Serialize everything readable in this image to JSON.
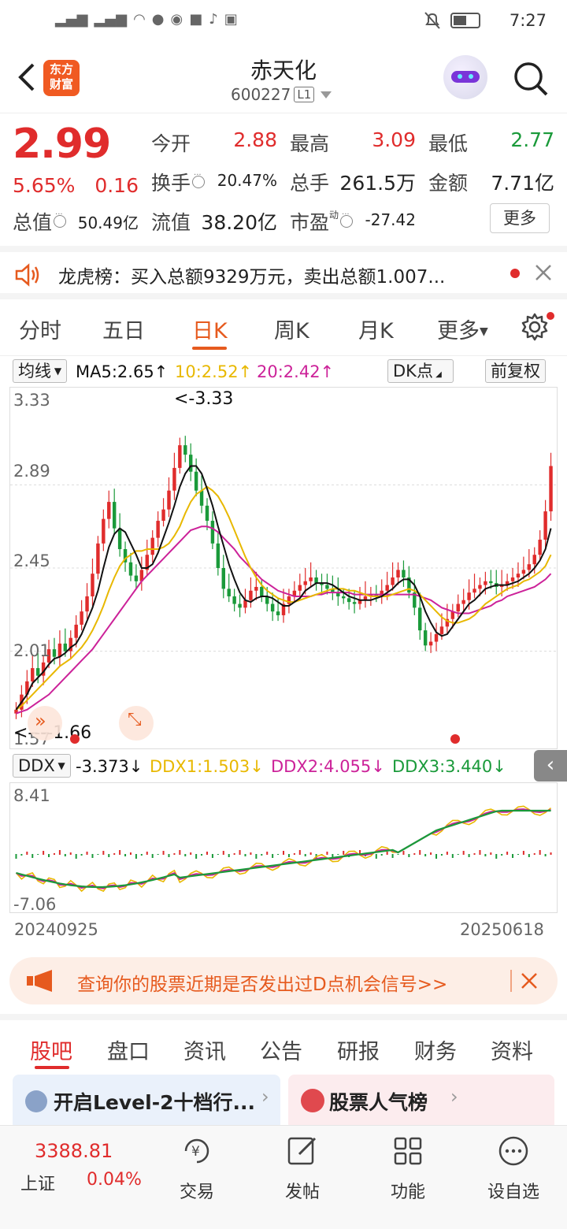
{
  "status_bar": {
    "time": "7:27"
  },
  "header": {
    "back_label": "返回",
    "logo_line1": "东方",
    "logo_line2": "财富",
    "stock_name": "赤天化",
    "stock_code": "600227",
    "level": "L1"
  },
  "quote": {
    "price": "2.99",
    "change_pct": "5.65%",
    "change": "0.16",
    "open_label": "今开",
    "open": "2.88",
    "high_label": "最高",
    "high": "3.09",
    "low_label": "最低",
    "low": "2.77",
    "turnover_label": "换手",
    "turnover": "20.47%",
    "volume_label": "总手",
    "volume": "261.5万",
    "amount_label": "金额",
    "amount": "7.71亿",
    "total_mv_label": "总值",
    "total_mv": "50.49亿",
    "float_mv_label": "流值",
    "float_mv": "38.20亿",
    "pe_label": "市盈",
    "pe_sup": "动",
    "pe": "-27.42",
    "more_label": "更多"
  },
  "notice": {
    "text": "龙虎榜：买入总额9329万元，卖出总额1.007..."
  },
  "period_tabs": [
    "分时",
    "五日",
    "日K",
    "周K",
    "月K",
    "更多"
  ],
  "active_period": "日K",
  "chart_head": {
    "ma_select": "均线",
    "ma5": "MA5:2.65↑",
    "ma10": "10:2.52↑",
    "ma20": "20:2.42↑",
    "dk_select": "DK点",
    "adjust": "前复权"
  },
  "colors": {
    "accent": "#e65a1e",
    "up": "#e02c2c",
    "down": "#1a9a3a",
    "ma5": "#111111",
    "ma10": "#e8b800",
    "ma20": "#cc2299",
    "ddx3": "#1a9a3a"
  },
  "kline_axis": {
    "y_top": "3.33",
    "y_2": "2.89",
    "y_3": "2.45",
    "y_4": "2.01",
    "y_bottom": "1.57",
    "max_mark": "<-3.33",
    "min_mark": "<----1.66"
  },
  "ddx_head": {
    "select": "DDX",
    "ddx": "-3.373↓",
    "ddx1": "DDX1:1.503↓",
    "ddx2": "DDX2:4.055↓",
    "ddx3": "DDX3:3.440↓"
  },
  "ddx_axis": {
    "y_top": "8.41",
    "y_bottom": "-7.06",
    "date_start": "20240925",
    "date_end": "20250618"
  },
  "promo": {
    "text": "查询你的股票近期是否发出过D点机会信号>>"
  },
  "bottom_tabs": [
    "股吧",
    "盘口",
    "资讯",
    "公告",
    "研报",
    "财务",
    "资料"
  ],
  "cards": {
    "left": "开启Level-2十档行...",
    "right": "股票人气榜"
  },
  "footer": {
    "index_value": "3388.81",
    "index_name": "上证",
    "index_change": "0.04%",
    "trade": "交易",
    "post": "发帖",
    "function": "功能",
    "custom": "设自选"
  },
  "chart_data": {
    "type": "candlestick",
    "x_start": "20240925",
    "x_end": "20250618",
    "ylim": [
      1.57,
      3.33
    ],
    "max": 3.33,
    "min": 1.66,
    "close": [
      1.7,
      1.78,
      1.85,
      1.92,
      1.88,
      1.95,
      2.02,
      1.98,
      2.05,
      2.01,
      2.08,
      2.15,
      2.22,
      2.3,
      2.42,
      2.58,
      2.71,
      2.8,
      2.66,
      2.55,
      2.48,
      2.41,
      2.38,
      2.44,
      2.52,
      2.61,
      2.7,
      2.76,
      2.86,
      2.98,
      3.1,
      3.05,
      2.96,
      2.86,
      2.78,
      2.7,
      2.58,
      2.45,
      2.34,
      2.3,
      2.26,
      2.24,
      2.28,
      2.33,
      2.35,
      2.3,
      2.26,
      2.22,
      2.2,
      2.26,
      2.3,
      2.33,
      2.36,
      2.38,
      2.4,
      2.37,
      2.36,
      2.34,
      2.32,
      2.3,
      2.29,
      2.27,
      2.26,
      2.28,
      2.3,
      2.31,
      2.3,
      2.33,
      2.36,
      2.4,
      2.44,
      2.4,
      2.32,
      2.24,
      2.12,
      2.04,
      2.06,
      2.1,
      2.14,
      2.18,
      2.22,
      2.26,
      2.28,
      2.32,
      2.34,
      2.36,
      2.38,
      2.37,
      2.35,
      2.36,
      2.38,
      2.4,
      2.42,
      2.44,
      2.47,
      2.52,
      2.6,
      2.75,
      2.99
    ],
    "ma5": [
      1.7,
      1.74,
      1.78,
      1.84,
      1.87,
      1.9,
      1.94,
      1.97,
      1.98,
      2.0,
      2.03,
      2.05,
      2.1,
      2.17,
      2.24,
      2.33,
      2.45,
      2.56,
      2.63,
      2.66,
      2.64,
      2.58,
      2.52,
      2.45,
      2.45,
      2.47,
      2.53,
      2.61,
      2.69,
      2.78,
      2.88,
      2.95,
      2.99,
      2.99,
      2.95,
      2.87,
      2.78,
      2.67,
      2.57,
      2.47,
      2.39,
      2.32,
      2.28,
      2.27,
      2.29,
      2.3,
      2.3,
      2.29,
      2.27,
      2.25,
      2.25,
      2.27,
      2.29,
      2.33,
      2.35,
      2.37,
      2.37,
      2.37,
      2.36,
      2.34,
      2.32,
      2.3,
      2.29,
      2.28,
      2.28,
      2.28,
      2.29,
      2.3,
      2.32,
      2.34,
      2.37,
      2.39,
      2.39,
      2.36,
      2.3,
      2.22,
      2.16,
      2.11,
      2.09,
      2.1,
      2.14,
      2.18,
      2.22,
      2.26,
      2.28,
      2.31,
      2.34,
      2.35,
      2.36,
      2.36,
      2.36,
      2.37,
      2.38,
      2.4,
      2.42,
      2.45,
      2.49,
      2.55,
      2.66
    ],
    "ma10": [
      1.7,
      1.72,
      1.75,
      1.78,
      1.81,
      1.84,
      1.87,
      1.9,
      1.93,
      1.95,
      1.97,
      2.0,
      2.03,
      2.07,
      2.12,
      2.18,
      2.25,
      2.33,
      2.4,
      2.46,
      2.5,
      2.52,
      2.54,
      2.54,
      2.55,
      2.55,
      2.55,
      2.56,
      2.58,
      2.62,
      2.67,
      2.74,
      2.8,
      2.84,
      2.86,
      2.88,
      2.86,
      2.83,
      2.78,
      2.72,
      2.65,
      2.58,
      2.51,
      2.45,
      2.4,
      2.36,
      2.33,
      2.31,
      2.29,
      2.28,
      2.27,
      2.27,
      2.28,
      2.29,
      2.3,
      2.31,
      2.32,
      2.33,
      2.34,
      2.34,
      2.34,
      2.33,
      2.33,
      2.32,
      2.31,
      2.3,
      2.3,
      2.3,
      2.3,
      2.31,
      2.32,
      2.33,
      2.34,
      2.33,
      2.31,
      2.28,
      2.25,
      2.22,
      2.19,
      2.17,
      2.16,
      2.16,
      2.17,
      2.18,
      2.2,
      2.23,
      2.26,
      2.28,
      2.3,
      2.32,
      2.34,
      2.35,
      2.36,
      2.38,
      2.39,
      2.41,
      2.43,
      2.46,
      2.52
    ],
    "ma20": [
      1.68,
      1.69,
      1.7,
      1.72,
      1.74,
      1.76,
      1.78,
      1.81,
      1.84,
      1.87,
      1.9,
      1.93,
      1.96,
      1.99,
      2.02,
      2.06,
      2.1,
      2.14,
      2.18,
      2.22,
      2.26,
      2.3,
      2.34,
      2.38,
      2.41,
      2.44,
      2.47,
      2.5,
      2.53,
      2.56,
      2.59,
      2.62,
      2.65,
      2.66,
      2.67,
      2.67,
      2.66,
      2.64,
      2.61,
      2.58,
      2.55,
      2.51,
      2.48,
      2.45,
      2.42,
      2.39,
      2.37,
      2.35,
      2.33,
      2.32,
      2.31,
      2.3,
      2.3,
      2.3,
      2.3,
      2.31,
      2.31,
      2.32,
      2.32,
      2.32,
      2.32,
      2.32,
      2.31,
      2.31,
      2.31,
      2.31,
      2.31,
      2.31,
      2.31,
      2.31,
      2.31,
      2.31,
      2.31,
      2.31,
      2.3,
      2.29,
      2.28,
      2.26,
      2.24,
      2.23,
      2.22,
      2.21,
      2.21,
      2.21,
      2.22,
      2.23,
      2.24,
      2.25,
      2.27,
      2.28,
      2.3,
      2.31,
      2.32,
      2.33,
      2.34,
      2.35,
      2.37,
      2.39,
      2.42
    ]
  }
}
